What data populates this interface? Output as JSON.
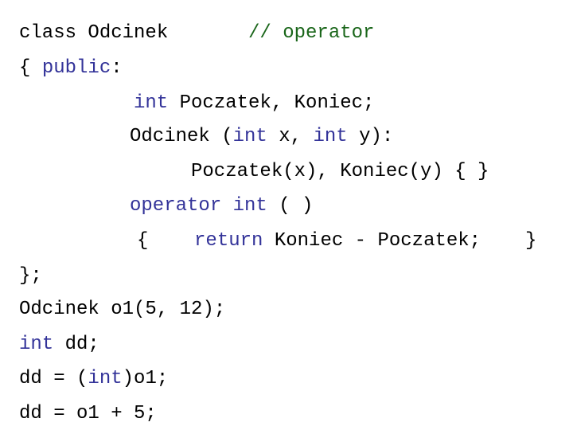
{
  "slide": {
    "background_color": "#ffffff",
    "language": "C++",
    "colors": {
      "plain": "#000000",
      "keyword": "#333399",
      "comment": "#1a661a"
    }
  },
  "code": {
    "line1": {
      "declaration": "class Odcinek",
      "comment": "// operator"
    },
    "line2": {
      "brace": "{ ",
      "keyword": "public",
      "colon": ":"
    },
    "line3": {
      "keyword": "int",
      "rest": " Poczatek, Koniec;"
    },
    "line4": {
      "name": "Odcinek (",
      "keyword1": "int",
      "mid": " x, ",
      "keyword2": "int",
      "tail": " y):"
    },
    "line5": {
      "text": "Poczatek(x), Koniec(y) { }"
    },
    "line6": {
      "keyword": "operator int",
      "tail": " ( )"
    },
    "line7": {
      "open_brace": "{",
      "gap": "    ",
      "keyword": "return",
      "expression": " Koniec - Poczatek;",
      "close_brace": "}"
    },
    "line8": {
      "text": "};"
    },
    "line9": {
      "text": "Odcinek o1(5, 12);"
    },
    "line10": {
      "keyword": "int",
      "rest": " dd;"
    },
    "line11": {
      "prefix": "dd = (",
      "keyword": "int",
      "suffix": ")o1;"
    },
    "line12": {
      "text": "dd = o1 + 5;"
    }
  }
}
